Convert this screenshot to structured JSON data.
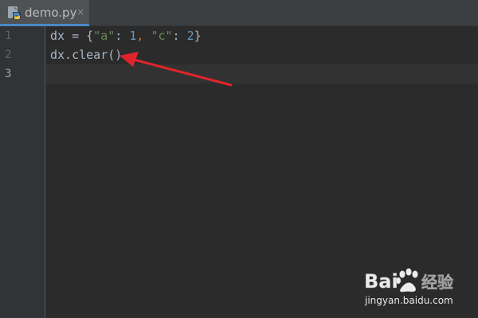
{
  "tab": {
    "filename": "demo.py",
    "close_glyph": "×",
    "icon": "python-file-icon"
  },
  "gutter": {
    "line_numbers": [
      "1",
      "2",
      "3"
    ]
  },
  "editor": {
    "lines": [
      {
        "tokens": [
          {
            "t": "dx = {",
            "k": "plain"
          },
          {
            "t": "\"a\"",
            "k": "str"
          },
          {
            "t": ": ",
            "k": "plain"
          },
          {
            "t": "1",
            "k": "num"
          },
          {
            "t": ", ",
            "k": "punc"
          },
          {
            "t": "\"c\"",
            "k": "str"
          },
          {
            "t": ": ",
            "k": "plain"
          },
          {
            "t": "2",
            "k": "num"
          },
          {
            "t": "}",
            "k": "plain"
          }
        ]
      },
      {
        "tokens": [
          {
            "t": "dx.clear()",
            "k": "plain"
          }
        ]
      },
      {
        "tokens": []
      }
    ],
    "current_line": 3
  },
  "annotation": {
    "arrow_color": "#e0242b"
  },
  "watermark": {
    "brand": "Bai",
    "brand_suffix": "经验",
    "url": "jingyan.baidu.com"
  },
  "colors": {
    "background": "#2b2b2b",
    "gutter": "#313335",
    "tab_active": "#4e5254",
    "tab_underline": "#4a88c7",
    "string": "#6a8759",
    "number": "#6897bb",
    "text": "#a9b7c6"
  }
}
